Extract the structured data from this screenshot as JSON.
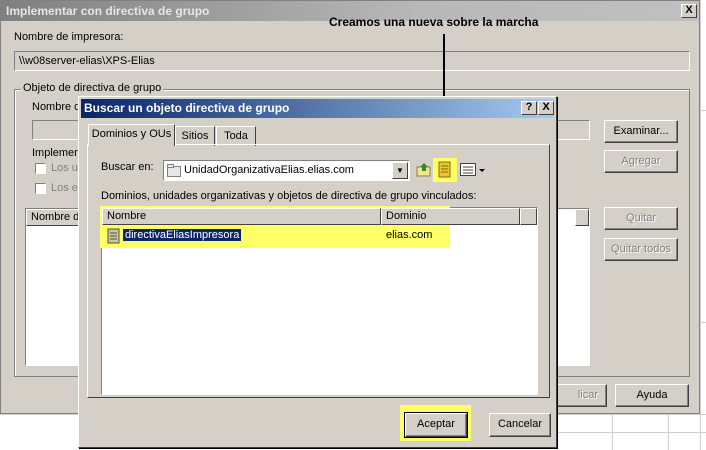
{
  "main_dialog": {
    "title": "Implementar con directiva de grupo",
    "close_glyph": "X",
    "printer_name_label": "Nombre de impresora:",
    "printer_name_value": "\\\\w08server-elias\\XPS-Elias",
    "gpo_group_title": "Objeto de directiva de grupo",
    "gpo_name_label": "Nombre d",
    "implement_label": "Implemen",
    "checkbox_users": "Los us",
    "checkbox_computers": "Los eq",
    "list_col_name": "Nombre d",
    "browse_button": "Examinar...",
    "add_button": "Agregar",
    "remove_button": "Quitar",
    "remove_all_button": "Quitar todos",
    "apply_button": "licar",
    "help_button": "Ayuda"
  },
  "search_dialog": {
    "title": "Buscar un objeto directiva de grupo",
    "help_glyph": "?",
    "close_glyph": "X",
    "tabs": [
      {
        "label": "Dominios y OUs",
        "active": true
      },
      {
        "label": "Sitios",
        "active": false
      },
      {
        "label": "Toda",
        "active": false
      }
    ],
    "look_in_label": "Buscar en:",
    "look_in_value": "UnidadOrganizativaElias.elias.com",
    "list_caption": "Dominios, unidades organizativas y objetos de directiva de grupo vinculados:",
    "columns": [
      "Nombre",
      "Dominio"
    ],
    "rows": [
      {
        "name": "directivaEliasImpresora",
        "domain": "elias.com",
        "selected": true
      }
    ],
    "ok_button": "Aceptar",
    "cancel_button": "Cancelar"
  },
  "annotation": {
    "text": "Creamos una nueva sobre la marcha"
  },
  "colors": {
    "highlight": "#ffff66",
    "selection": "#0a246a",
    "title_active": "#0a246a",
    "face": "#d4d0c8"
  }
}
